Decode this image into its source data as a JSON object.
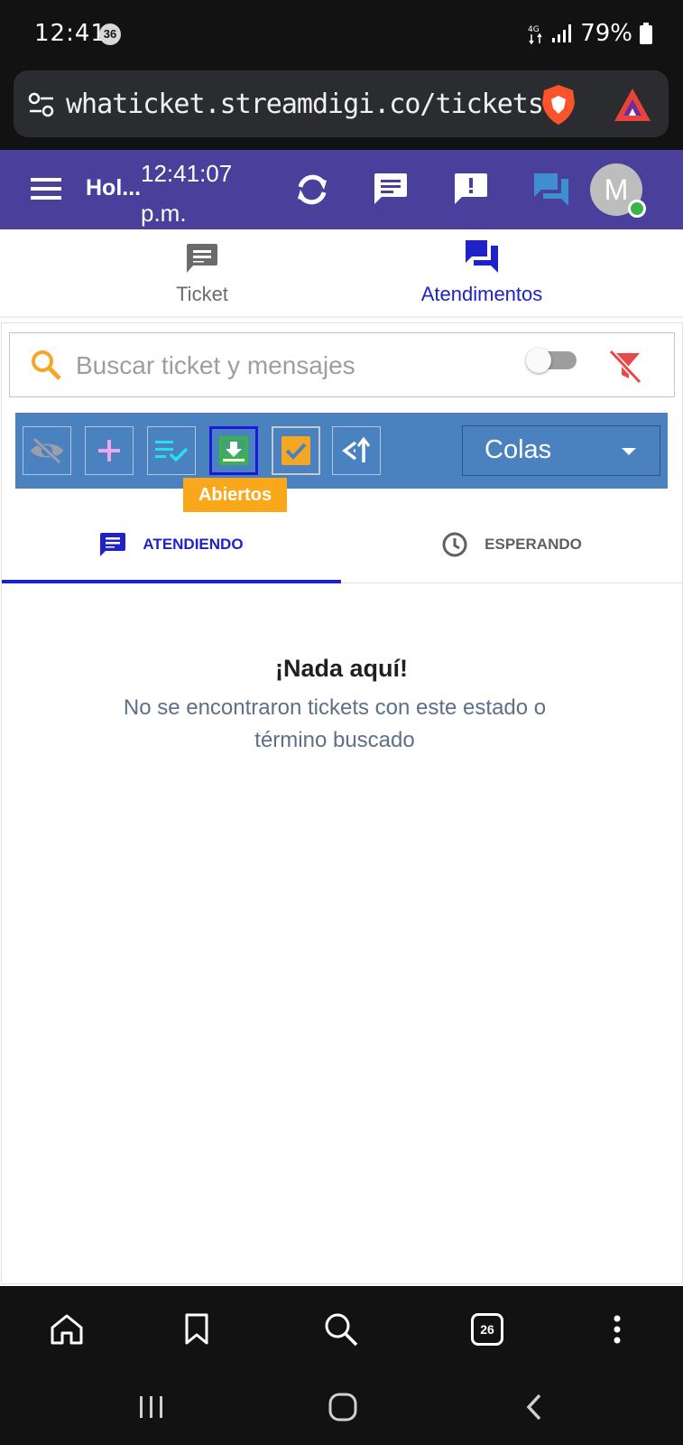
{
  "status_bar": {
    "time": "12:41",
    "notification_count": "36",
    "battery": "79%"
  },
  "browser": {
    "url": "whaticket.streamdigi.co/tickets",
    "tab_count": "26"
  },
  "appbar": {
    "title": "Hol...",
    "clock_time": "12:41:07",
    "clock_period": "p.m.",
    "avatar_initial": "M",
    "color": "#4b3f9c"
  },
  "main_tabs": [
    {
      "label": "Ticket",
      "selected": false
    },
    {
      "label": "Atendimentos",
      "selected": true
    }
  ],
  "search": {
    "placeholder": "Buscar ticket y mensajes"
  },
  "toolbar": {
    "color": "#4a81bf",
    "queue_select": "Colas",
    "tooltip": "Abiertos"
  },
  "sub_tabs": [
    {
      "label": "ATENDIENDO",
      "selected": true
    },
    {
      "label": "ESPERANDO",
      "selected": false
    }
  ],
  "empty_state": {
    "title": "¡Nada aquí!",
    "message": "No se encontraron tickets con este estado o término buscado"
  },
  "colors": {
    "accent": "#1f21c9",
    "tooltip": "#f9a81c",
    "online": "#3bb54a"
  }
}
